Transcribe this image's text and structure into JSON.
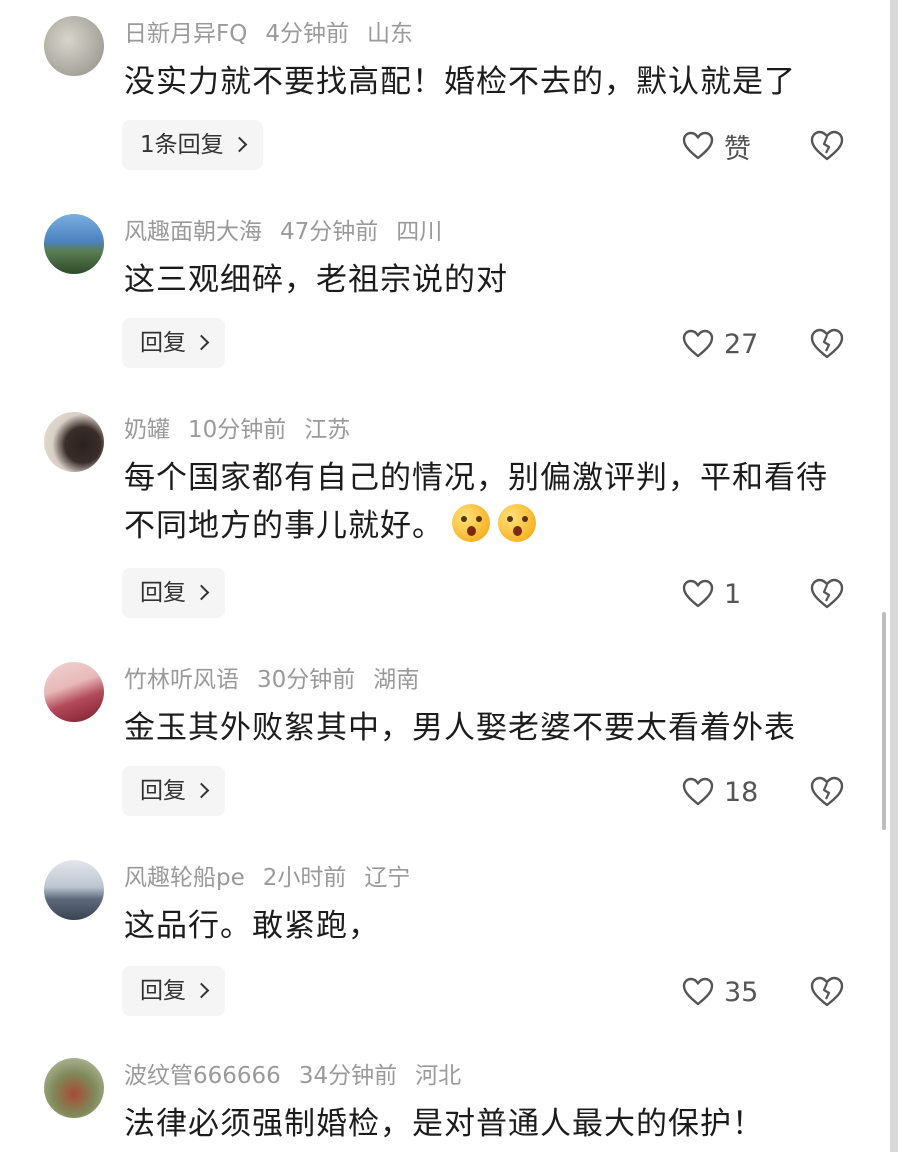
{
  "comments": [
    {
      "username": "日新月异FQ",
      "time": "4分钟前",
      "location": "山东",
      "text": "没实力就不要找高配！婚检不去的，默认就是了",
      "reply_label": "1条回复",
      "like_label": "赞",
      "avatar_colors": [
        "#c9c7bd",
        "#8f8d85"
      ]
    },
    {
      "username": "风趣面朝大海",
      "time": "47分钟前",
      "location": "四川",
      "text": "这三观细碎，老祖宗说的对",
      "reply_label": "回复",
      "like_label": "27",
      "avatar_colors": [
        "#6fa3d8",
        "#2d5a2c"
      ]
    },
    {
      "username": "奶罐",
      "time": "10分钟前",
      "location": "江苏",
      "text": "每个国家都有自己的情况，别偏激评判，平和看待不同地方的事儿就好。",
      "emoji": [
        "astonished-emoji",
        "astonished-emoji"
      ],
      "reply_label": "回复",
      "like_label": "1",
      "avatar_colors": [
        "#d8cfc5",
        "#3a2d2a"
      ]
    },
    {
      "username": "竹林听风语",
      "time": "30分钟前",
      "location": "湖南",
      "text": "金玉其外败絮其中，男人娶老婆不要太看着外表",
      "reply_label": "回复",
      "like_label": "18",
      "avatar_colors": [
        "#e8b8b8",
        "#9a2a3a"
      ]
    },
    {
      "username": "风趣轮船pe",
      "time": "2小时前",
      "location": "辽宁",
      "text": "这品行。敢紧跑，",
      "reply_label": "回复",
      "like_label": "35",
      "avatar_colors": [
        "#cfd6df",
        "#4a5566"
      ]
    },
    {
      "username": "波纹管666666",
      "time": "34分钟前",
      "location": "河北",
      "text": "法律必须强制婚检，是对普通人最大的保护！",
      "avatar_colors": [
        "#8a9a6a",
        "#9a3a2a"
      ]
    }
  ],
  "icons": {
    "like": "heart-icon",
    "dislike": "broken-heart-icon",
    "reply": "chevron-right-icon"
  }
}
